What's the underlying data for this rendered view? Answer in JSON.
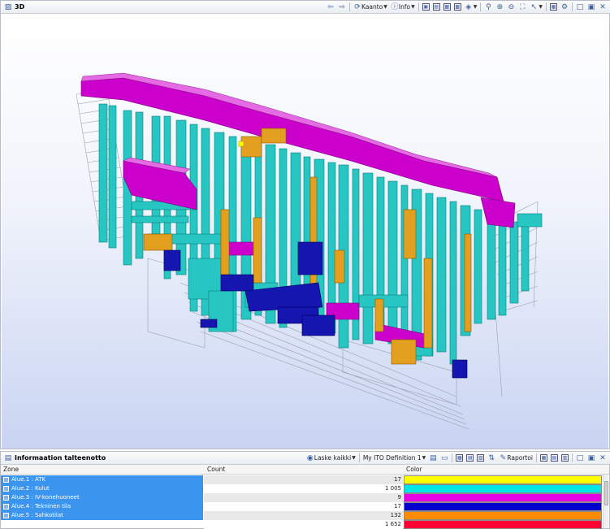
{
  "view3d": {
    "title": "3D",
    "toolbar": {
      "rotate_label": "Kaanto",
      "info_label": "Info"
    }
  },
  "info_panel": {
    "title": "Informaation talteenotto",
    "toolbar": {
      "calc_label": "Laske kaikki",
      "definition_label": "My ITO Definition 1",
      "report_label": "Raportoi"
    },
    "columns": [
      "Zone",
      "Count",
      "Color"
    ],
    "rows": [
      {
        "zone": "Alue.1 : ATK",
        "count": "17",
        "color": "#ffff00"
      },
      {
        "zone": "Alue.2 : Kulut",
        "count": "1 005",
        "color": "#00e5e5"
      },
      {
        "zone": "Alue.3 : IV-konehuoneet",
        "count": "9",
        "color": "#e600e6"
      },
      {
        "zone": "Alue.4 : Tekninen tila",
        "count": "17",
        "color": "#0000cc"
      },
      {
        "zone": "Alue.5 : Sahkotilat",
        "count": "132",
        "color": "#ff8c00"
      },
      {
        "zone": "",
        "count": "1 652",
        "color": "#ff0033"
      }
    ]
  },
  "colors": {
    "cyan_duct": "#27c6c2",
    "magenta_block": "#cc00cc",
    "orange_block": "#e3a020",
    "blue_block": "#1515b0",
    "selection": "#3b95ee"
  }
}
